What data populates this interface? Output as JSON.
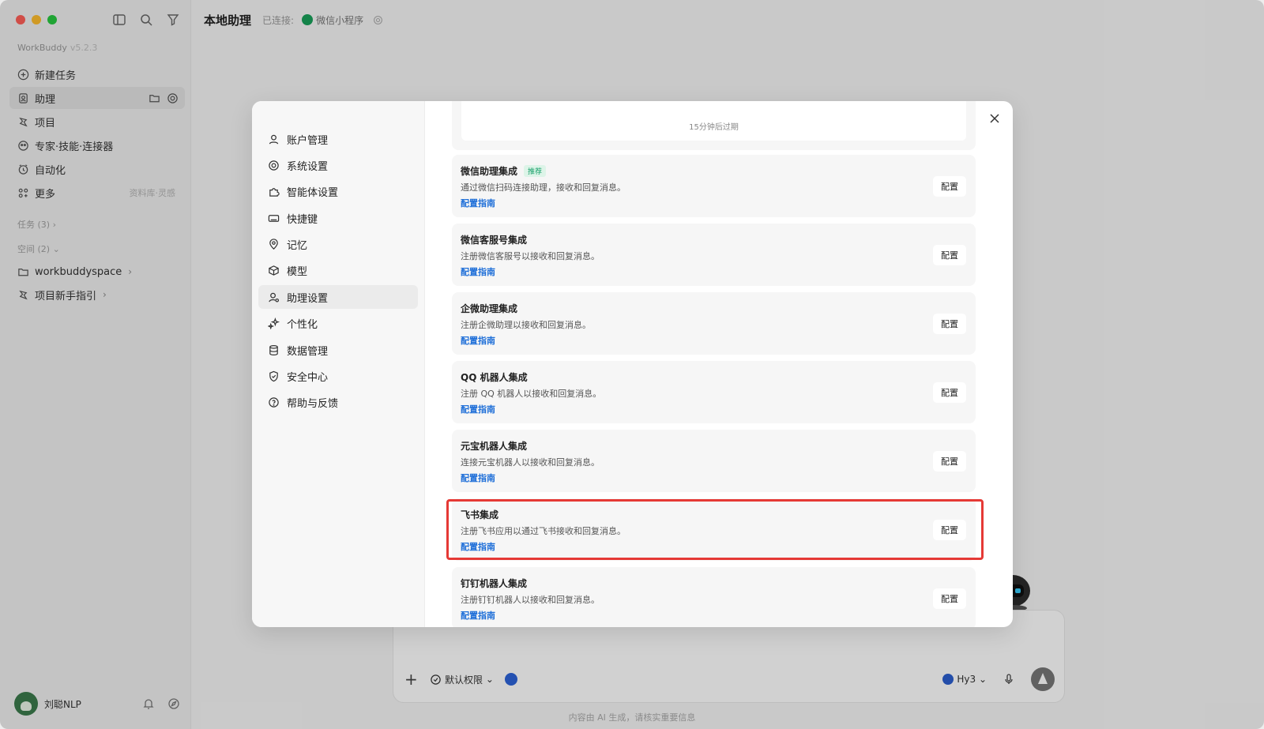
{
  "app": {
    "name": "WorkBuddy",
    "version": "v5.2.3"
  },
  "sidebar": {
    "items": [
      {
        "label": "新建任务",
        "icon": "plus-circle-icon"
      },
      {
        "label": "助理",
        "icon": "assistant-icon"
      },
      {
        "label": "项目",
        "icon": "project-icon"
      },
      {
        "label": "专家·技能·连接器",
        "icon": "expert-icon"
      },
      {
        "label": "自动化",
        "icon": "clock-icon"
      },
      {
        "label": "更多",
        "icon": "grid-icon",
        "hint": "资料库·灵感"
      }
    ],
    "sections": {
      "tasks": "任务 (3)",
      "spaces": "空间 (2)"
    },
    "folders": [
      {
        "label": "workbuddyspace"
      },
      {
        "label": "项目新手指引"
      }
    ],
    "user": {
      "name": "刘聪NLP"
    }
  },
  "topbar": {
    "title": "本地助理",
    "connected_label": "已连接:",
    "connection_name": "微信小程序"
  },
  "composer": {
    "permission_label": "默认权限",
    "model_label": "Hy3",
    "disclaimer": "内容由 AI 生成，请核实重要信息"
  },
  "settings_modal": {
    "menu": [
      {
        "label": "账户管理",
        "icon": "user-icon"
      },
      {
        "label": "系统设置",
        "icon": "gear-icon"
      },
      {
        "label": "智能体设置",
        "icon": "puzzle-icon"
      },
      {
        "label": "快捷键",
        "icon": "keyboard-icon"
      },
      {
        "label": "记忆",
        "icon": "memory-icon"
      },
      {
        "label": "模型",
        "icon": "cube-icon"
      },
      {
        "label": "助理设置",
        "icon": "assistant-settings-icon",
        "active": true
      },
      {
        "label": "个性化",
        "icon": "sparkle-icon"
      },
      {
        "label": "数据管理",
        "icon": "database-icon"
      },
      {
        "label": "安全中心",
        "icon": "shield-icon"
      },
      {
        "label": "帮助与反馈",
        "icon": "help-icon"
      }
    ],
    "top_card_text": "15分钟后过期",
    "integrations": [
      {
        "title": "微信助理集成",
        "tag": "推荐",
        "desc": "通过微信扫码连接助理，接收和回复消息。",
        "link": "配置指南",
        "button": "配置"
      },
      {
        "title": "微信客服号集成",
        "desc": "注册微信客服号以接收和回复消息。",
        "link": "配置指南",
        "button": "配置"
      },
      {
        "title": "企微助理集成",
        "desc": "注册企微助理以接收和回复消息。",
        "link": "配置指南",
        "button": "配置"
      },
      {
        "title": "QQ 机器人集成",
        "desc": "注册 QQ 机器人以接收和回复消息。",
        "link": "配置指南",
        "button": "配置"
      },
      {
        "title": "元宝机器人集成",
        "desc": "连接元宝机器人以接收和回复消息。",
        "link": "配置指南",
        "button": "配置"
      },
      {
        "title": "飞书集成",
        "desc": "注册飞书应用以通过飞书接收和回复消息。",
        "link": "配置指南",
        "button": "配置",
        "highlighted": true
      },
      {
        "title": "钉钉机器人集成",
        "desc": "注册钉钉机器人以接收和回复消息。",
        "link": "配置指南",
        "button": "配置"
      }
    ]
  },
  "colors": {
    "link": "#1f6fd8",
    "highlight": "#e53935",
    "tag_green": "#18a06a"
  }
}
